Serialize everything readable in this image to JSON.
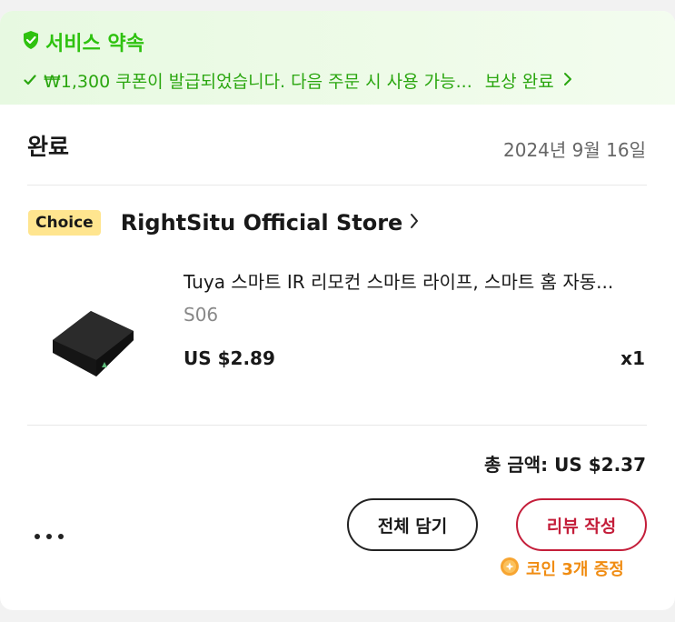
{
  "promise": {
    "title": "서비스 약속",
    "message": "₩1,300 쿠폰이 발급되었습니다. 다음 주문 시 사용 가능...",
    "status": "보상 완료"
  },
  "order": {
    "status": "완료",
    "date": "2024년 9월 16일"
  },
  "store": {
    "badge": "Choice",
    "name": "RightSitu Official Store"
  },
  "product": {
    "title": "Tuya 스마트 IR 리모컨 스마트 라이프, 스마트 홈 자동...",
    "sku": "S06",
    "price": "US $2.89",
    "qty": "x1"
  },
  "summary": {
    "total": "총 금액: US $2.37"
  },
  "actions": {
    "add_all": "전체 담기",
    "review": "리뷰 작성",
    "coin_reward": "코인 3개 증정"
  },
  "icons": {
    "promise": "shield-check-icon",
    "check": "check-icon",
    "chevron": "chevron-right-icon",
    "more": "more-dots-icon",
    "coin": "coin-icon"
  },
  "colors": {
    "promise_green": "#2ec20f",
    "review_red": "#c41e3a",
    "coin_orange": "#f08c12",
    "choice_yellow": "#ffe58f"
  }
}
